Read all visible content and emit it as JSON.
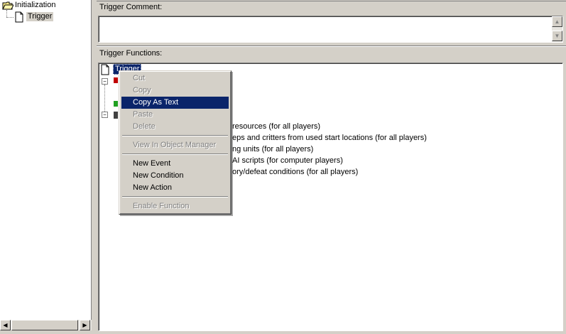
{
  "tree": {
    "items": [
      {
        "label": "Initialization",
        "icon": "folder-open-icon"
      },
      {
        "label": "Trigger",
        "icon": "document-icon"
      }
    ]
  },
  "trigger_comment": {
    "label": "Trigger Comment:",
    "value": ""
  },
  "trigger_functions": {
    "label": "Trigger Functions:",
    "root_label": "Trigger",
    "lines": [
      "resources (for all players)",
      "eps and critters from used start locations (for all players)",
      "ng units (for all players)",
      "AI scripts (for computer players)",
      "ory/defeat conditions (for all players)"
    ]
  },
  "context_menu": {
    "items": [
      {
        "label": "Cut",
        "enabled": false
      },
      {
        "label": "Copy",
        "enabled": false
      },
      {
        "label": "Copy As Text",
        "enabled": true,
        "highlighted": true
      },
      {
        "label": "Paste",
        "enabled": false
      },
      {
        "label": "Delete",
        "enabled": false
      },
      {
        "label": "View In Object Manager",
        "enabled": false
      },
      {
        "label": "New Event",
        "enabled": true
      },
      {
        "label": "New Condition",
        "enabled": true
      },
      {
        "label": "New Action",
        "enabled": true
      },
      {
        "label": "Enable Function",
        "enabled": false
      }
    ]
  },
  "colors": {
    "face": "#d4d0c8",
    "highlight": "#0a246a",
    "disabled_text": "#808080"
  }
}
